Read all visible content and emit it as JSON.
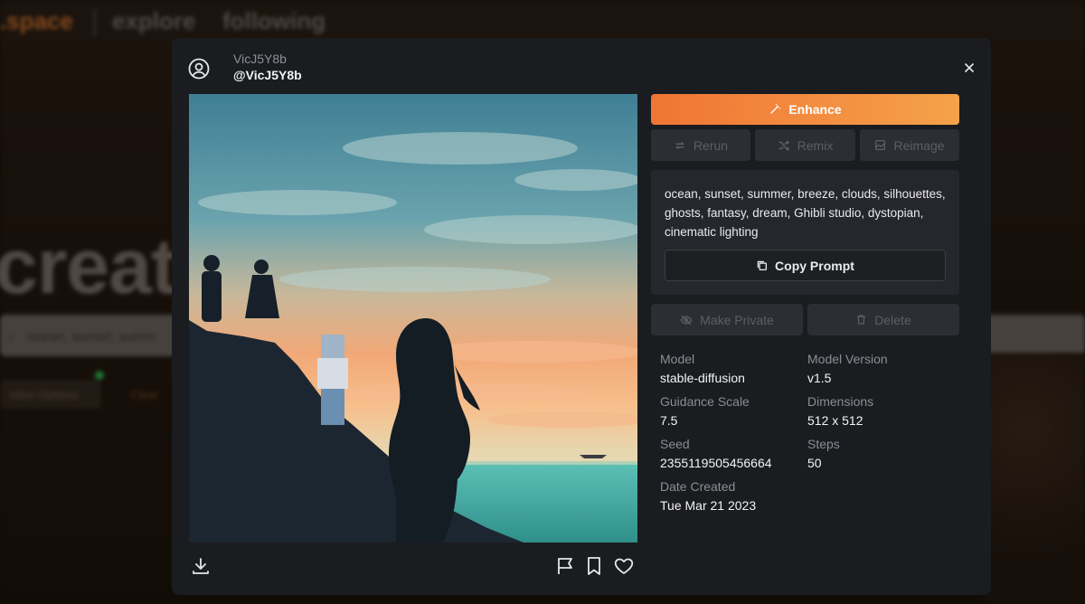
{
  "background": {
    "logo_text": ".space",
    "nav": {
      "explore": "explore",
      "following": "following"
    },
    "hero_text": "creat",
    "search_value": "ocean, sunset, summ",
    "view_options": "View Options",
    "clear": "Clear"
  },
  "modal": {
    "user": {
      "name": "VicJ5Y8b",
      "handle": "@VicJ5Y8b"
    },
    "image": {
      "icon": "generated-image",
      "description_colors": [
        "#4b8fa3",
        "#f4a36a",
        "#1b2a33"
      ]
    },
    "actions": {
      "enhance": "Enhance",
      "rerun": "Rerun",
      "remix": "Remix",
      "reimage": "Reimage",
      "make_private": "Make Private",
      "delete": "Delete"
    },
    "prompt": {
      "text": "ocean, sunset, summer, breeze, clouds, silhouettes, ghosts, fantasy, dream, Ghibli studio, dystopian, cinematic lighting",
      "copy_label": "Copy Prompt"
    },
    "metadata": {
      "model_label": "Model",
      "model_value": "stable-diffusion",
      "model_version_label": "Model Version",
      "model_version_value": "v1.5",
      "guidance_label": "Guidance Scale",
      "guidance_value": "7.5",
      "dimensions_label": "Dimensions",
      "dimensions_value": "512 x 512",
      "seed_label": "Seed",
      "seed_value": "2355119505456664",
      "steps_label": "Steps",
      "steps_value": "50",
      "date_label": "Date Created",
      "date_value": "Tue Mar 21 2023"
    },
    "colors": {
      "accent_start": "#f07534",
      "accent_end": "#f5a24a",
      "surface": "#1b1c20",
      "panel": "#26272c"
    }
  }
}
